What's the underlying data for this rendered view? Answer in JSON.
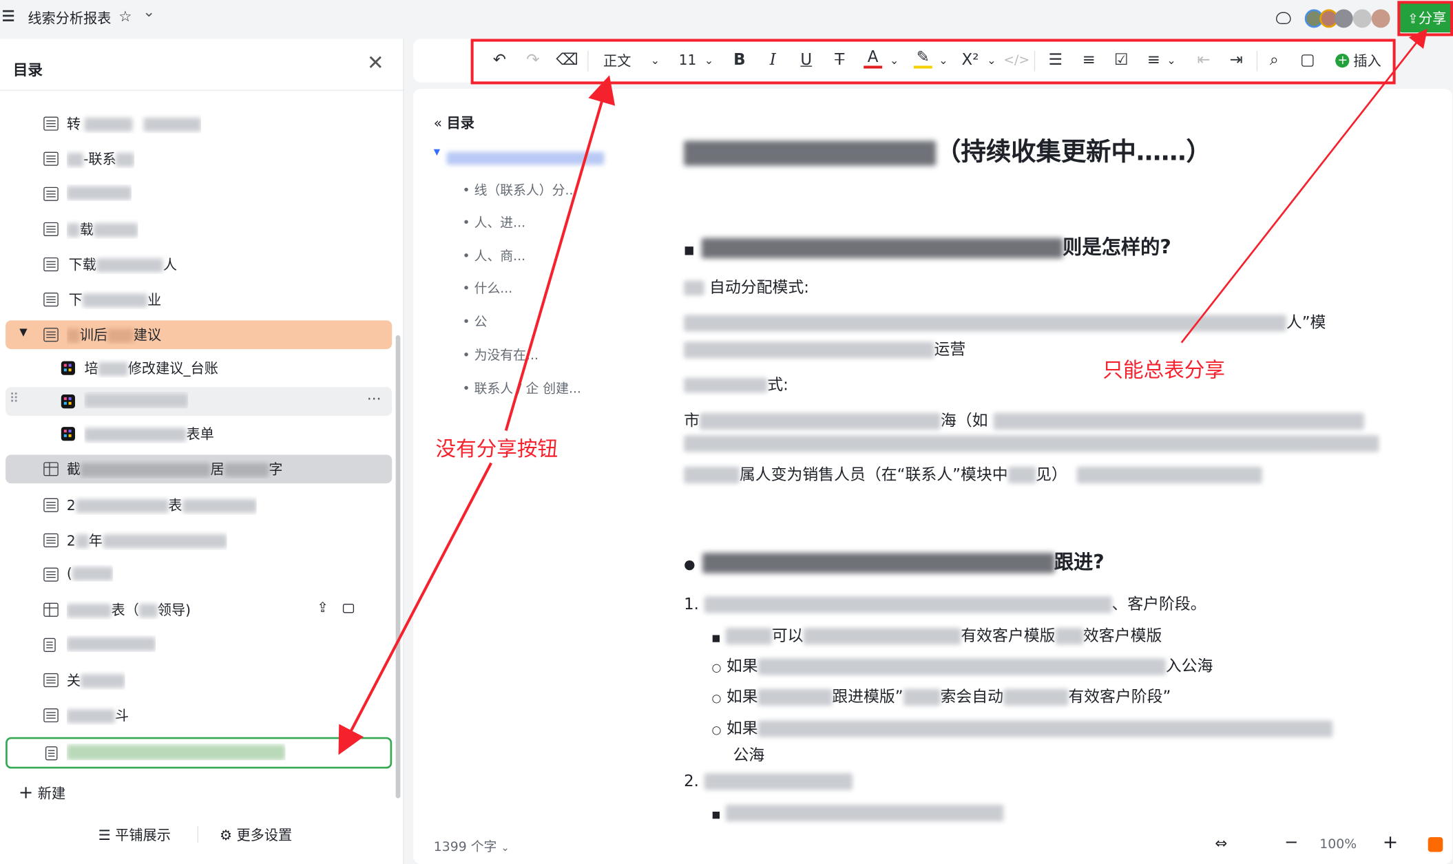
{
  "app": {
    "title": "线索分析报表",
    "star_icon": "☆",
    "chevron": "⌄"
  },
  "share": {
    "label": "分享"
  },
  "sidebar": {
    "header": "目录",
    "items": [
      {
        "prefix": "转",
        "icon": "doc"
      },
      {
        "prefix": "",
        "mid": "-联系",
        "icon": "doc"
      },
      {
        "prefix": "",
        "icon": "doc"
      },
      {
        "prefix": "",
        "mid": "载",
        "icon": "doc"
      },
      {
        "prefix": "下载",
        "mid": "人",
        "icon": "doc"
      },
      {
        "prefix": "下",
        "mid": "业",
        "icon": "doc"
      },
      {
        "prefix": "",
        "mid": "训后",
        "suffix": "建议",
        "icon": "doc"
      },
      {
        "prefix": "培",
        "mid": "修改建议_台账",
        "icon": "app"
      },
      {
        "prefix": "",
        "icon": "app"
      },
      {
        "prefix": "",
        "mid": "表单",
        "icon": "app"
      },
      {
        "prefix": "截",
        "mid": "居",
        "suffix": "字",
        "icon": "grid"
      },
      {
        "prefix": "2",
        "mid": "表",
        "icon": "doc"
      },
      {
        "prefix": "2",
        "mid": "年",
        "icon": "doc"
      },
      {
        "prefix": "(",
        "icon": "board"
      },
      {
        "prefix": "",
        "mid": "表（",
        "suffix": "领导)",
        "icon": "grid"
      },
      {
        "prefix": "",
        "icon": "page"
      },
      {
        "prefix": "关",
        "icon": "doc"
      },
      {
        "prefix": "",
        "mid": "斗",
        "icon": "doc"
      },
      {
        "prefix": "",
        "icon": "page"
      }
    ],
    "new_label": "新建",
    "tile_label": "平铺展示",
    "more_settings_label": "更多设置"
  },
  "toolbar": {
    "style_label": "正文",
    "font_size": "11",
    "insert_label": "插入"
  },
  "doc": {
    "toc_label": "目录",
    "toc_items": [
      "• 线（联系人）分...",
      "• 人、进...",
      "• 人、商...",
      "• 什么...",
      "• 公",
      "• 为没有在...",
      "• 联系人 / 企 创建..."
    ],
    "title_tail": "（持续收集更新中……）",
    "h1_tail": "则是怎样的?",
    "p1": "自动分配模式:",
    "p1b_tail": "人”模",
    "p1c_tail": "运营",
    "p2": "式:",
    "p3a": "市",
    "p3b": "海（如",
    "p3c": "属人变为销售人员（在“联系人”模块中",
    "p3d": "见）",
    "h2_tail": "跟进?",
    "l1": "1.",
    "l1_tail": "、客户阶段。",
    "b1a": "可以",
    "b1b": "有效客户模版",
    "b1c": "效客户模版",
    "b2a": "如果",
    "b2b": "入公海",
    "b3a": "如果",
    "b3b": "跟进模版”",
    "b3c": "索会自动",
    "b3d": "有效客户阶段”",
    "b4a": "如果",
    "b4b": "公海",
    "l2": "2.",
    "word_count": "1399 个字",
    "zoom": "100%"
  },
  "annotations": {
    "no_share": "没有分享按钮",
    "only_total": "只能总表分享"
  },
  "colors": {
    "share_green": "#22a13d",
    "highlight_orange": "#f9c7a4",
    "annotation_red": "#f5222d",
    "selected_border": "#34a853"
  }
}
